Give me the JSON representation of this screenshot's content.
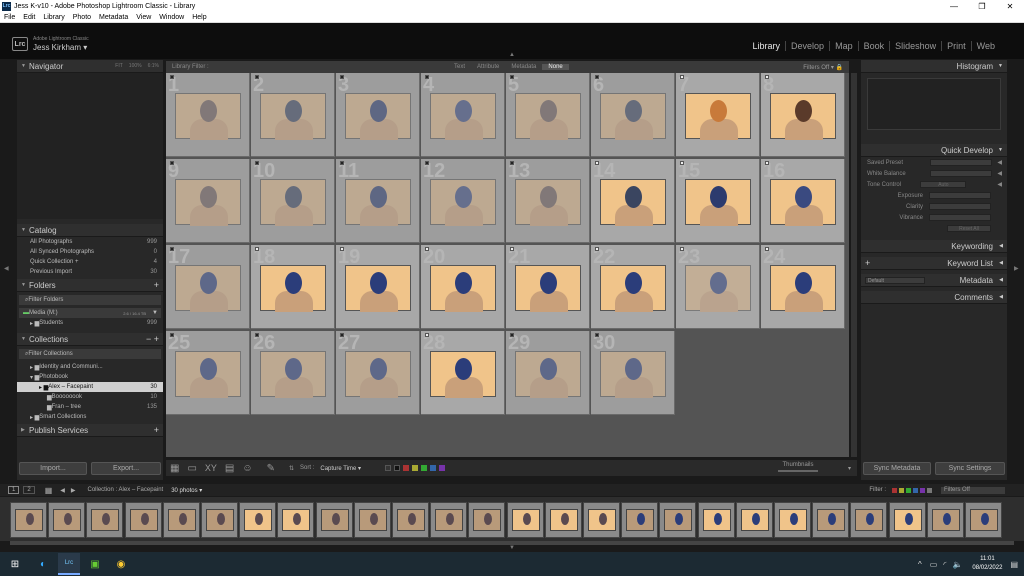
{
  "window": {
    "title": "Jess K-v10 - Adobe Photoshop Lightroom Classic - Library",
    "app_icon": "Lrc"
  },
  "menu": [
    "File",
    "Edit",
    "Library",
    "Photo",
    "Metadata",
    "View",
    "Window",
    "Help"
  ],
  "identity": {
    "app": "Adobe Lightroom Classic",
    "user": "Jess Kirkham",
    "logo": "Lrc"
  },
  "modules": [
    "Library",
    "Develop",
    "Map",
    "Book",
    "Slideshow",
    "Print",
    "Web"
  ],
  "active_module": "Library",
  "navigator": {
    "title": "Navigator",
    "options": [
      "FIT",
      "100%",
      "6:1%"
    ]
  },
  "catalog": {
    "title": "Catalog",
    "items": [
      {
        "label": "All Photographs",
        "count": "999"
      },
      {
        "label": "All Synced Photographs",
        "count": "0"
      },
      {
        "label": "Quick Collection +",
        "count": "4"
      },
      {
        "label": "Previous Import",
        "count": "30"
      }
    ]
  },
  "folders": {
    "title": "Folders",
    "filter": "Filter Folders",
    "volume": "Media (M:)",
    "volume_info": "2.6 / 16.4 TB",
    "items": [
      {
        "label": "Students",
        "count": "999"
      }
    ]
  },
  "collections": {
    "title": "Collections",
    "filter": "Filter Collections",
    "items": [
      {
        "label": "Identity and Communi...",
        "count": ""
      },
      {
        "label": "Photobook",
        "count": ""
      },
      {
        "label": "Alex – Facepaint",
        "count": "30"
      },
      {
        "label": "Boooooook",
        "count": "10"
      },
      {
        "label": "Fran – tree",
        "count": "135"
      },
      {
        "label": "Smart Collections",
        "count": ""
      }
    ]
  },
  "publish": {
    "title": "Publish Services"
  },
  "import_label": "Import...",
  "export_label": "Export...",
  "library_filter": {
    "label": "Library Filter :",
    "tabs": [
      "Text",
      "Attribute",
      "Metadata",
      "None"
    ],
    "active": "None",
    "status": "Filters Off"
  },
  "grid_numbers": [
    "1",
    "2",
    "3",
    "4",
    "5",
    "6",
    "7",
    "8",
    "9",
    "10",
    "11",
    "12",
    "13",
    "14",
    "15",
    "16",
    "17",
    "18",
    "19",
    "20",
    "21",
    "22",
    "23",
    "24",
    "25",
    "26",
    "27",
    "28",
    "29",
    "30"
  ],
  "toolbar": {
    "sort_label": "Sort :",
    "sort_value": "Capture Time",
    "thumbnails_label": "Thumbnails"
  },
  "right": {
    "histogram": "Histogram",
    "quick_develop": "Quick Develop",
    "saved_preset": "Saved Preset",
    "white_balance": "White Balance",
    "tone_control": "Tone Control",
    "auto": "Auto",
    "exposure": "Exposure",
    "clarity": "Clarity",
    "vibrance": "Vibrance",
    "reset_all": "Reset All",
    "keywording": "Keywording",
    "keyword_list": "Keyword List",
    "metadata": "Metadata",
    "metadata_preset": "Default",
    "comments": "Comments",
    "sync_metadata": "Sync Metadata",
    "sync_settings": "Sync Settings"
  },
  "filmstrip": {
    "collection": "Collection : Alex – Facepaint",
    "count": "30 photos",
    "filter_label": "Filter :",
    "filter_value": "Filters Off",
    "pages": [
      "1",
      "2"
    ]
  },
  "taskbar": {
    "time": "11:01",
    "date": "08/02/2022"
  },
  "colors": {
    "accent": "#e6e6e6",
    "panel": "#282828",
    "grid_bg": "#545454",
    "cell": "#9d9d9d"
  }
}
